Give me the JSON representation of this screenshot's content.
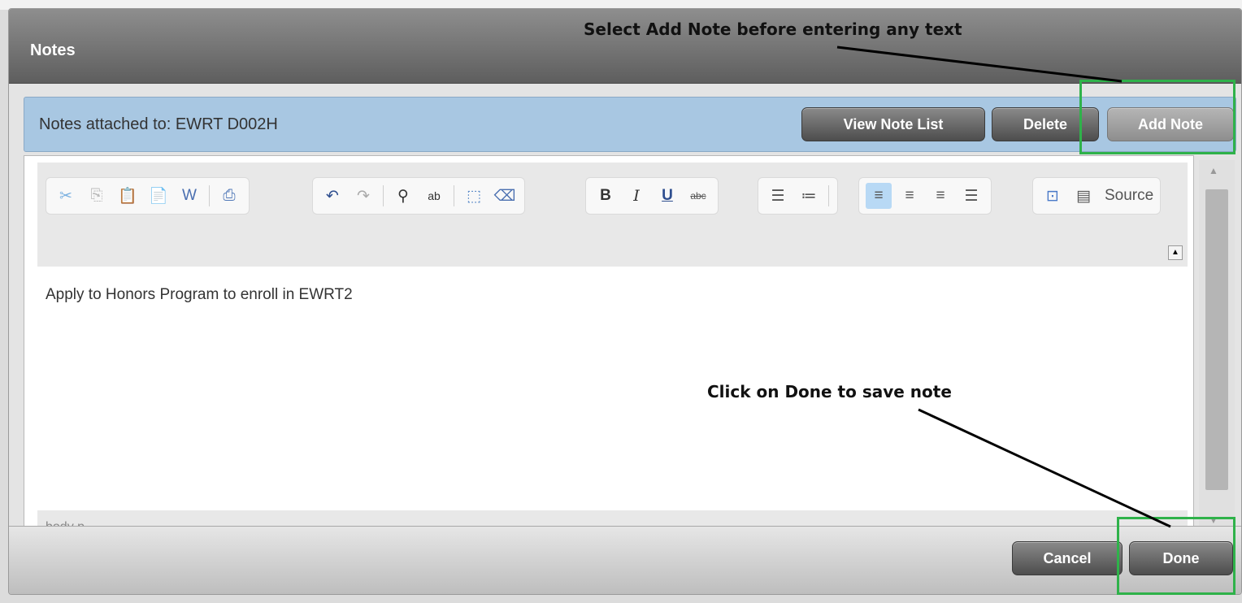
{
  "dialog": {
    "title": "Notes"
  },
  "annotations": {
    "top": "Select Add Note before entering any text",
    "bottom": "Click on Done to save note"
  },
  "header": {
    "attached_label": "Notes attached to:  EWRT D002H",
    "buttons": {
      "view_note_list": "View Note List",
      "delete": "Delete",
      "add_note": "Add Note"
    }
  },
  "toolbar": {
    "groups": [
      [
        "cut-icon",
        "copy-icon",
        "paste-icon",
        "paste-text-icon",
        "paste-word-icon",
        "print-icon"
      ],
      [
        "undo-icon",
        "redo-icon",
        "find-icon",
        "replace-icon",
        "select-all-icon",
        "remove-format-icon"
      ],
      [
        "bold-icon",
        "italic-icon",
        "underline-icon",
        "strikethrough-icon"
      ],
      [
        "numbered-list-icon",
        "bulleted-list-icon"
      ],
      [
        "align-left-icon",
        "align-center-icon",
        "align-right-icon",
        "justify-icon"
      ],
      [
        "maximize-icon",
        "source-icon"
      ]
    ],
    "source_label": "Source"
  },
  "editor": {
    "content": "Apply to Honors Program to enroll in EWRT2",
    "status_path": "body   p"
  },
  "footer": {
    "cancel": "Cancel",
    "done": "Done"
  },
  "colors": {
    "highlight": "#2fb24a",
    "header_bg": "#a8c7e2",
    "title_bg": "#6f6f6f"
  }
}
